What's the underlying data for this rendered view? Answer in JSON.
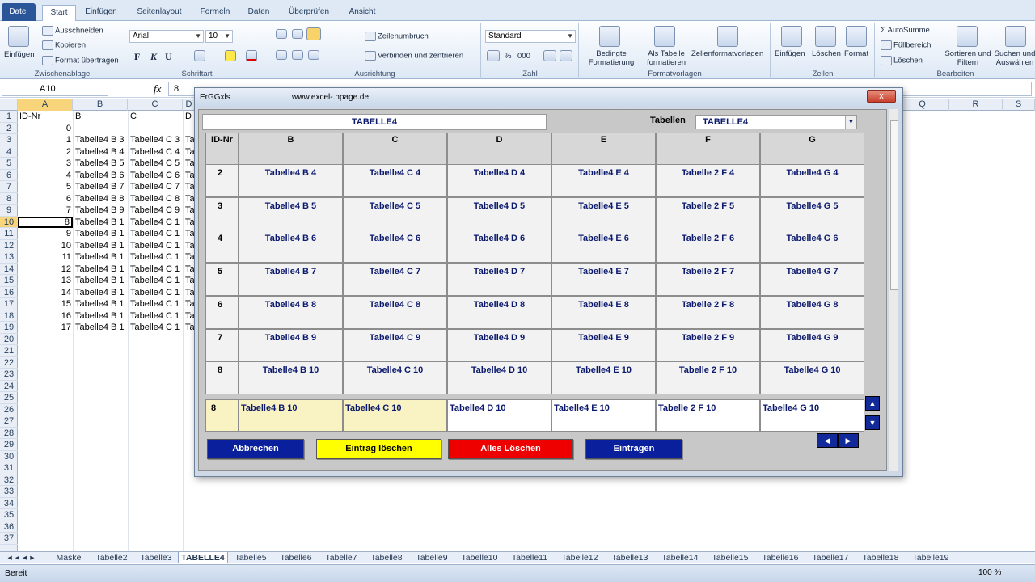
{
  "ribbon": {
    "tabs": [
      "Datei",
      "Start",
      "Einfügen",
      "Seitenlayout",
      "Formeln",
      "Daten",
      "Überprüfen",
      "Ansicht"
    ],
    "clipboard": {
      "paste": "Einfügen",
      "cut": "Ausschneiden",
      "copy": "Kopieren",
      "format": "Format übertragen",
      "label": "Zwischenablage"
    },
    "font": {
      "name": "Arial",
      "size": "10",
      "label": "Schriftart",
      "bold": "F",
      "italic": "K",
      "underline": "U"
    },
    "alignment": {
      "wrap": "Zeilenumbruch",
      "merge": "Verbinden und zentrieren",
      "label": "Ausrichtung"
    },
    "number": {
      "format": "Standard",
      "label": "Zahl",
      "percent": "%",
      "thousands": "000"
    },
    "styles": {
      "conditional": "Bedingte Formatierung",
      "table": "Als Tabelle formatieren",
      "cellstyles": "Zellenformatvorlagen",
      "label": "Formatvorlagen"
    },
    "cells": {
      "insert": "Einfügen",
      "delete": "Löschen",
      "format": "Format",
      "label": "Zellen"
    },
    "editing": {
      "autosum": "AutoSumme",
      "fill": "Füllbereich",
      "clear": "Löschen",
      "sort": "Sortieren und Filtern",
      "find": "Suchen und Auswählen",
      "label": "Bearbeiten"
    }
  },
  "formula": {
    "namebox": "A10",
    "fx": "fx",
    "value": "8"
  },
  "grid": {
    "columns": [
      "A",
      "B",
      "C",
      "D",
      "Q",
      "R",
      "S"
    ],
    "rows": [
      "1",
      "2",
      "3",
      "4",
      "5",
      "6",
      "7",
      "8",
      "9",
      "10",
      "11",
      "12",
      "13",
      "14",
      "15",
      "16",
      "17",
      "18",
      "19",
      "20",
      "21",
      "22",
      "23",
      "24",
      "25",
      "26",
      "27",
      "28",
      "29",
      "30",
      "31",
      "32",
      "33",
      "34",
      "35",
      "36",
      "37"
    ],
    "colA": [
      "ID-Nr",
      "0",
      "1",
      "2",
      "3",
      "4",
      "5",
      "6",
      "7",
      "8",
      "9",
      "10",
      "11",
      "12",
      "13",
      "14",
      "15",
      "16",
      "17"
    ],
    "colB": [
      "B",
      "",
      "Tabelle4  B 3",
      "Tabelle4  B 4",
      "Tabelle4  B 5",
      "Tabelle4  B 6",
      "Tabelle4  B 7",
      "Tabelle4  B 8",
      "Tabelle4  B 9",
      "Tabelle4  B 1",
      "Tabelle4  B 1",
      "Tabelle4  B 1",
      "Tabelle4  B 1",
      "Tabelle4  B 1",
      "Tabelle4  B 1",
      "Tabelle4  B 1",
      "Tabelle4  B 1",
      "Tabelle4  B 1",
      "Tabelle4  B 1"
    ],
    "colC": [
      "C",
      "",
      "Tabelle4  C 3",
      "Tabelle4  C 4",
      "Tabelle4  C 5",
      "Tabelle4  C 6",
      "Tabelle4  C 7",
      "Tabelle4  C 8",
      "Tabelle4  C 9",
      "Tabelle4  C 1",
      "Tabelle4  C 1",
      "Tabelle4  C 1",
      "Tabelle4  C 1",
      "Tabelle4  C 1",
      "Tabelle4  C 1",
      "Tabelle4  C 1",
      "Tabelle4  C 1",
      "Tabelle4  C 1",
      "Tabelle4  C 1"
    ],
    "colD": [
      "D",
      "",
      "Ta",
      "Ta",
      "Ta",
      "Ta",
      "Ta",
      "Ta",
      "Ta",
      "Ta",
      "Ta",
      "Ta",
      "Ta",
      "Ta",
      "Ta",
      "Ta",
      "Ta",
      "Ta",
      "Ta"
    ]
  },
  "sheets": [
    "Maske",
    "Tabelle2",
    "Tabelle3",
    "TABELLE4",
    "Tabelle5",
    "Tabelle6",
    "Tabelle7",
    "Tabelle8",
    "Tabelle9",
    "Tabelle10",
    "Tabelle11",
    "Tabelle12",
    "Tabelle13",
    "Tabelle14",
    "Tabelle15",
    "Tabelle16",
    "Tabelle17",
    "Tabelle18",
    "Tabelle19"
  ],
  "status": {
    "ready": "Bereit",
    "zoom": "100 %"
  },
  "dialog": {
    "title": "ErGGxls",
    "url": "www.excel-.npage.de",
    "close": "x",
    "sheet_name": "TABELLE4",
    "tables_label": "Tabellen",
    "tables_value": "TABELLE4",
    "headers": [
      "ID-Nr",
      "B",
      "C",
      "D",
      "E",
      "F",
      "G"
    ],
    "rows": [
      [
        "2",
        "Tabelle4  B 4",
        "Tabelle4  C 4",
        "Tabelle4  D 4",
        "Tabelle4  E 4",
        "Tabelle 2 F 4",
        "Tabelle4  G 4"
      ],
      [
        "3",
        "Tabelle4  B 5",
        "Tabelle4  C 5",
        "Tabelle4  D 5",
        "Tabelle4  E 5",
        "Tabelle 2 F 5",
        "Tabelle4  G 5"
      ],
      [
        "4",
        "Tabelle4  B 6",
        "Tabelle4  C 6",
        "Tabelle4  D 6",
        "Tabelle4  E 6",
        "Tabelle 2 F 6",
        "Tabelle4  G 6"
      ],
      [
        "5",
        "Tabelle4  B 7",
        "Tabelle4  C 7",
        "Tabelle4  D 7",
        "Tabelle4  E 7",
        "Tabelle 2 F 7",
        "Tabelle4  G 7"
      ],
      [
        "6",
        "Tabelle4  B 8",
        "Tabelle4  C 8",
        "Tabelle4  D 8",
        "Tabelle4  E 8",
        "Tabelle 2 F 8",
        "Tabelle4  G 8"
      ],
      [
        "7",
        "Tabelle4  B 9",
        "Tabelle4  C 9",
        "Tabelle4  D 9",
        "Tabelle4  E 9",
        "Tabelle 2 F 9",
        "Tabelle4  G 9"
      ],
      [
        "8",
        "Tabelle4  B 10",
        "Tabelle4  C 10",
        "Tabelle4  D 10",
        "Tabelle4  E 10",
        "Tabelle 2 F 10",
        "Tabelle4  G 10"
      ]
    ],
    "edit_row": [
      "8",
      "Tabelle4  B 10",
      "Tabelle4  C 10",
      "Tabelle4  D 10",
      "Tabelle4  E 10",
      "Tabelle 2 F 10",
      "Tabelle4  G 10"
    ],
    "buttons": {
      "cancel": "Abbrechen",
      "delete_entry": "Eintrag löschen",
      "delete_all": "Alles Löschen",
      "submit": "Eintragen"
    },
    "colors": {
      "cancel": "#0a1f9c",
      "delete_entry": "#ffff00",
      "delete_all": "#ee0000",
      "submit": "#0a1f9c"
    }
  }
}
